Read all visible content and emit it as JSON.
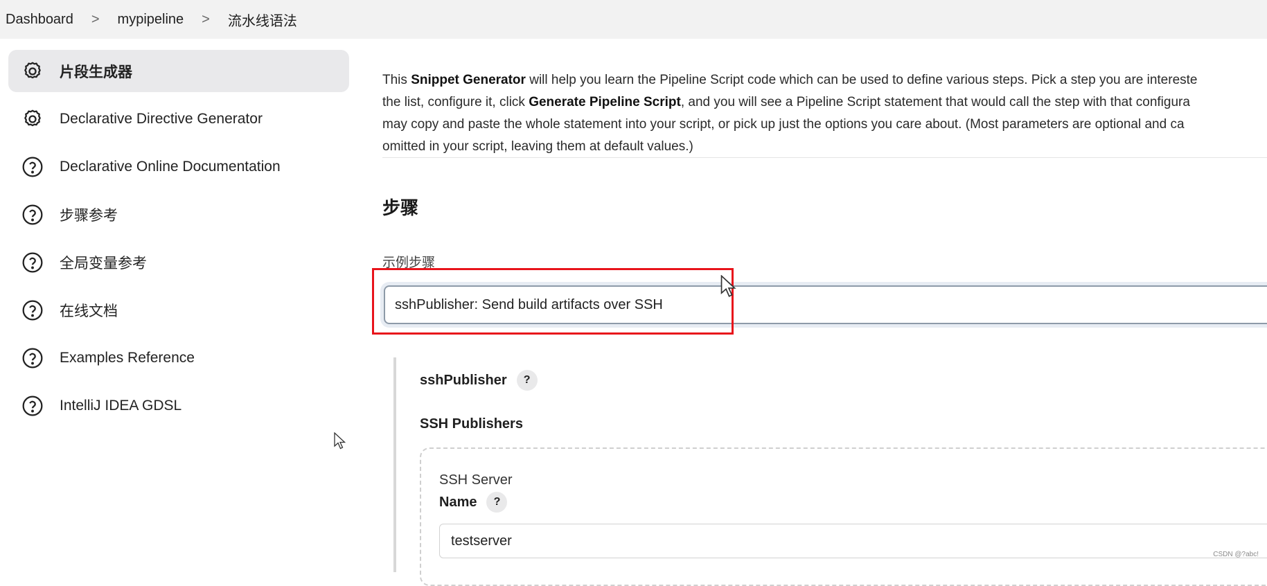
{
  "breadcrumb": {
    "items": [
      "Dashboard",
      "mypipeline",
      "流水线语法"
    ],
    "separator": ">"
  },
  "sidebar": {
    "items": [
      {
        "label": "片段生成器",
        "icon": "gear-icon",
        "active": true
      },
      {
        "label": "Declarative Directive Generator",
        "icon": "gear-icon"
      },
      {
        "label": "Declarative Online Documentation",
        "icon": "help-circle-icon"
      },
      {
        "label": "步骤参考",
        "icon": "help-circle-icon"
      },
      {
        "label": "全局变量参考",
        "icon": "help-circle-icon"
      },
      {
        "label": "在线文档",
        "icon": "help-circle-icon"
      },
      {
        "label": "Examples Reference",
        "icon": "help-circle-icon"
      },
      {
        "label": "IntelliJ IDEA GDSL",
        "icon": "help-circle-icon"
      }
    ]
  },
  "main": {
    "description": {
      "l1_a": "This ",
      "l1_b": "Snippet Generator",
      "l1_c": " will help you learn the Pipeline Script code which can be used to define various steps. Pick a step you are intereste",
      "l2_a": "the list, configure it, click ",
      "l2_b": "Generate Pipeline Script",
      "l2_c": ", and you will see a Pipeline Script statement that would call the step with that configura",
      "l3": "may copy and paste the whole statement into your script, or pick up just the options you care about. (Most parameters are optional and ca",
      "l4": "omitted in your script, leaving them at default values.)"
    },
    "section_title": "步骤",
    "sample_step_label": "示例步骤",
    "sample_step_value": "sshPublisher: Send build artifacts over SSH",
    "step_name": "sshPublisher",
    "help_symbol": "?",
    "ssh_publishers_title": "SSH Publishers",
    "ssh_server_label": "SSH Server",
    "name_label": "Name",
    "name_value": "testserver"
  },
  "watermark": "CSDN @?abc!",
  "colors": {
    "highlight": "#e8141b",
    "active_bg": "#e9e9eb",
    "topbar_bg": "#f2f2f2"
  }
}
